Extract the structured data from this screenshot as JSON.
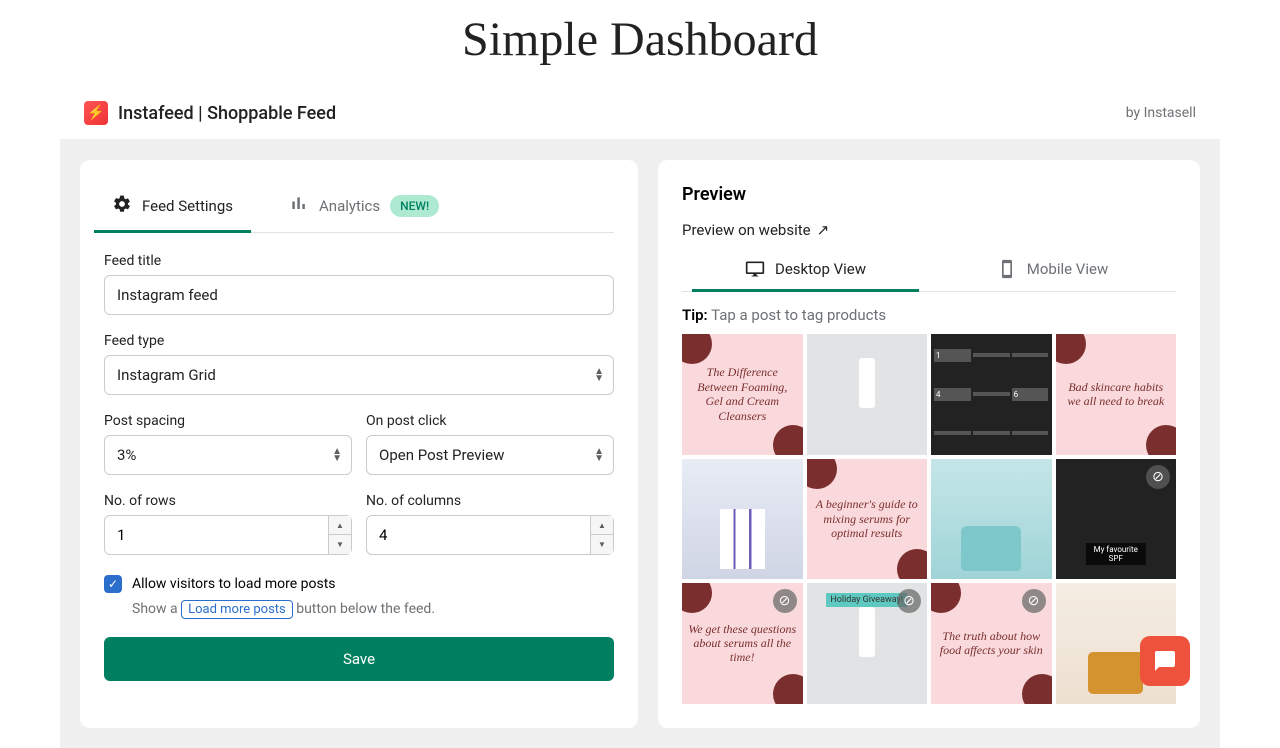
{
  "page_title": "Simple Dashboard",
  "app": {
    "title": "Instafeed | Shoppable Feed",
    "author": "by Instasell"
  },
  "tabs": {
    "settings": "Feed Settings",
    "analytics": "Analytics",
    "new_badge": "NEW!"
  },
  "form": {
    "feed_title_label": "Feed title",
    "feed_title_value": "Instagram feed",
    "feed_type_label": "Feed type",
    "feed_type_value": "Instagram Grid",
    "post_spacing_label": "Post spacing",
    "post_spacing_value": "3%",
    "on_click_label": "On post click",
    "on_click_value": "Open Post Preview",
    "rows_label": "No. of rows",
    "rows_value": "1",
    "cols_label": "No. of columns",
    "cols_value": "4",
    "checkbox_label": "Allow visitors to load more posts",
    "help_prefix": "Show a ",
    "help_pill": "Load more posts",
    "help_suffix": " button below the feed.",
    "save_label": "Save"
  },
  "preview": {
    "title": "Preview",
    "link_label": "Preview on website",
    "desktop_label": "Desktop View",
    "mobile_label": "Mobile View",
    "tip_label": "Tip:",
    "tip_text": "Tap a post to tag products"
  },
  "posts": [
    {
      "text": "The Difference Between Foaming, Gel and Cream Cleansers"
    },
    {
      "text": ""
    },
    {
      "text": ""
    },
    {
      "text": "Bad skincare habits we all need to break"
    },
    {
      "text": ""
    },
    {
      "text": "A beginner's guide to mixing serums for optimal results"
    },
    {
      "text": ""
    },
    {
      "text": ""
    },
    {
      "text": "We get these questions about serums all the time!"
    },
    {
      "text": "Holiday Giveaway!"
    },
    {
      "text": "The truth about how food affects your skin"
    },
    {
      "text": ""
    }
  ]
}
